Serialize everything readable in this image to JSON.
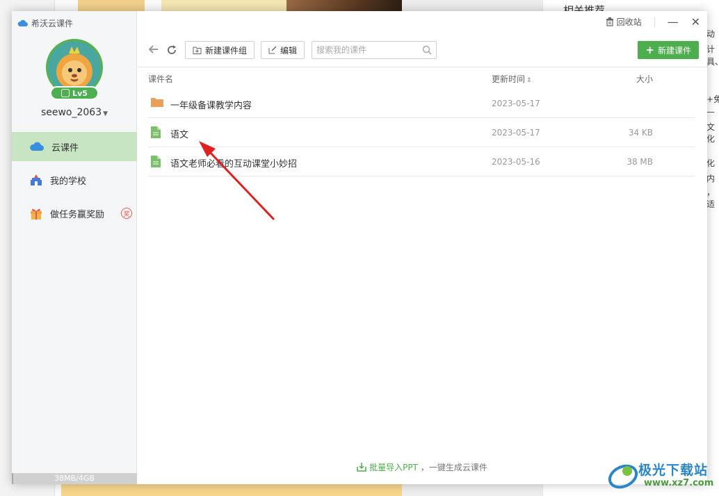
{
  "app": {
    "title": "希沃云课件"
  },
  "user": {
    "name": "seewo_2063",
    "level": "Lv5"
  },
  "sidebar": {
    "items": [
      {
        "label": "云课件",
        "icon": "cloud-icon",
        "active": true
      },
      {
        "label": "我的学校",
        "icon": "school-icon",
        "active": false
      },
      {
        "label": "做任务赢奖励",
        "icon": "gift-icon",
        "active": false,
        "badge": "奖"
      }
    ],
    "storage": {
      "text": "38MB/4GB",
      "used_fraction": 0.01
    }
  },
  "window": {
    "recycle_label": "回收站",
    "minimize": "—",
    "close": "✕"
  },
  "toolbar": {
    "new_group_label": "新建课件组",
    "edit_label": "编辑",
    "search_placeholder": "搜索我的课件",
    "new_courseware_label": "新建课件"
  },
  "table": {
    "columns": {
      "name": "课件名",
      "updated": "更新时间",
      "size": "大小"
    },
    "rows": [
      {
        "type": "folder",
        "name": "一年级备课教学内容",
        "updated": "2023-05-17",
        "size": ""
      },
      {
        "type": "file",
        "name": "语文",
        "updated": "2023-05-17",
        "size": "34 KB"
      },
      {
        "type": "file",
        "name": "语文老师必看的互动课堂小妙招",
        "updated": "2023-05-16",
        "size": "38 MB"
      }
    ]
  },
  "footer": {
    "link": "批量导入PPT",
    "text": "，一键生成云课件"
  },
  "background": {
    "right_title": "相关推荐",
    "right_bits": [
      "动",
      "计",
      "具、",
      "+免",
      "—",
      "文化",
      "化",
      "内",
      "，适"
    ]
  },
  "watermark": {
    "text": "极光下载站",
    "url": "www.xz7.com"
  },
  "colors": {
    "accent": "#4cae4c",
    "active_nav": "#c7e5c2",
    "arrow": "#e02020",
    "folder": "#e8a05a",
    "file": "#7bbf6a"
  }
}
